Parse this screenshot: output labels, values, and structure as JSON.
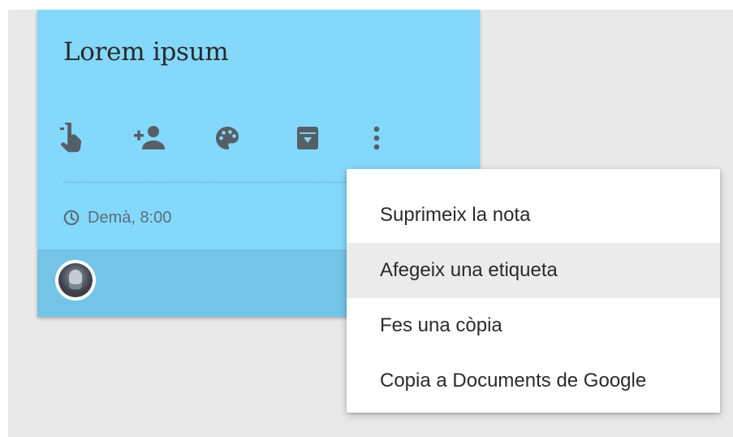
{
  "note": {
    "title": "Lorem ipsum",
    "color": "#84d8fc",
    "footer_color": "#74c4e7",
    "toolbar": [
      {
        "icon": "remind-me-icon"
      },
      {
        "icon": "collaborator-icon"
      },
      {
        "icon": "palette-icon"
      },
      {
        "icon": "archive-icon"
      },
      {
        "icon": "more-vert-icon"
      }
    ],
    "reminder": {
      "icon": "clock-icon",
      "text": "Demà, 8:00"
    },
    "collaborator_avatar": {
      "icon": "avatar"
    }
  },
  "menu": {
    "items": [
      {
        "label": "Suprimeix la nota"
      },
      {
        "label": "Afegeix una etiqueta",
        "highlighted": true
      },
      {
        "label": "Fes una còpia"
      },
      {
        "label": "Copia a Documents de Google"
      }
    ]
  },
  "colors": {
    "background": "#e9e9e9",
    "icon": "#555f66",
    "menu_hover": "#ebebeb"
  }
}
